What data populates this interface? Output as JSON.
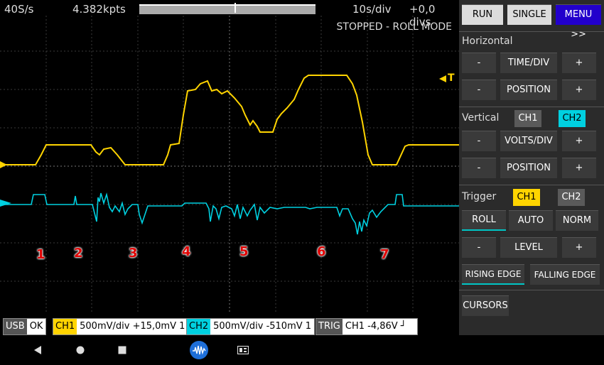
{
  "top": {
    "sample_rate": "40S/s",
    "points": "4.382kpts",
    "timebase": "10s/div",
    "h_offset": "+0,0 divs",
    "memory_view_position": 0.54
  },
  "screen": {
    "mode_text": "STOPPED - ROLL MODE",
    "trigger_marker": "T",
    "markers": [
      "1",
      "2",
      "3",
      "4",
      "5",
      "6",
      "7"
    ],
    "colors": {
      "ch1": "#ffd400",
      "ch2": "#00d0e0",
      "grid": "#555555",
      "marker": "#e00000"
    }
  },
  "panel": {
    "run": "RUN",
    "single": "SINGLE",
    "menu": "MENU >>",
    "horizontal": {
      "title": "Horizontal",
      "minus": "-",
      "plus": "+",
      "time_div": "TIME/DIV",
      "position": "POSITION"
    },
    "vertical": {
      "title": "Vertical",
      "ch1": "CH1",
      "ch2": "CH2",
      "selected": "CH2",
      "minus": "-",
      "plus": "+",
      "volts_div": "VOLTS/DIV",
      "position": "POSITION"
    },
    "trigger": {
      "title": "Trigger",
      "ch1": "CH1",
      "ch2": "CH2",
      "selected": "CH1",
      "roll": "ROLL",
      "auto": "AUTO",
      "norm": "NORM",
      "minus": "-",
      "plus": "+",
      "level": "LEVEL",
      "rising": "RISING EDGE",
      "falling": "FALLING EDGE"
    },
    "cursors": "CURSORS"
  },
  "status": {
    "usb_key": "USB",
    "usb_val": "OK",
    "ch1_key": "CH1",
    "ch1_val": "500mV/div  +15,0mV 1",
    "ch2_key": "CH2",
    "ch2_val": "500mV/div  -510mV 1",
    "trig_key": "TRIG",
    "trig_val": "CH1  -4,86V  ┘"
  },
  "navbar": {
    "icons": [
      "back-icon",
      "home-icon",
      "recents-icon",
      "scope-app-icon",
      "gallery-icon"
    ]
  }
}
